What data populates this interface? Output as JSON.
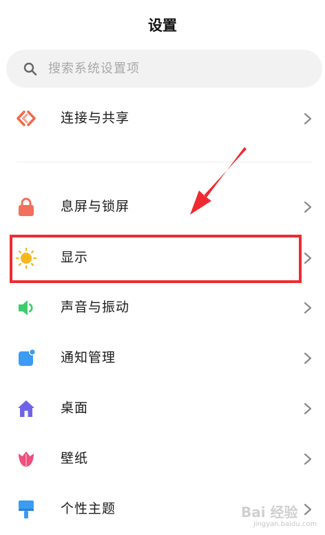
{
  "header": {
    "title": "设置"
  },
  "search": {
    "placeholder": "搜索系统设置项"
  },
  "items": [
    {
      "label": "连接与共享",
      "icon": "share-link-icon",
      "color": "#f26a4b"
    },
    {
      "label": "息屏与锁屏",
      "icon": "lock-icon",
      "color": "#f26f5b"
    },
    {
      "label": "显示",
      "icon": "sun-icon",
      "color": "#f6b81c"
    },
    {
      "label": "声音与振动",
      "icon": "speaker-icon",
      "color": "#3dcc6e"
    },
    {
      "label": "通知管理",
      "icon": "notification-icon",
      "color": "#3b9bf5"
    },
    {
      "label": "桌面",
      "icon": "home-icon",
      "color": "#6f64e8"
    },
    {
      "label": "壁纸",
      "icon": "tulip-icon",
      "color": "#ef4f7c"
    },
    {
      "label": "个性主题",
      "icon": "paintbrush-icon",
      "color": "#3a9cf2"
    }
  ],
  "annotation": {
    "highlight_color": "#f02a30"
  },
  "watermark": {
    "text": "Bai 经验",
    "url": "jingyan.baidu.com"
  }
}
